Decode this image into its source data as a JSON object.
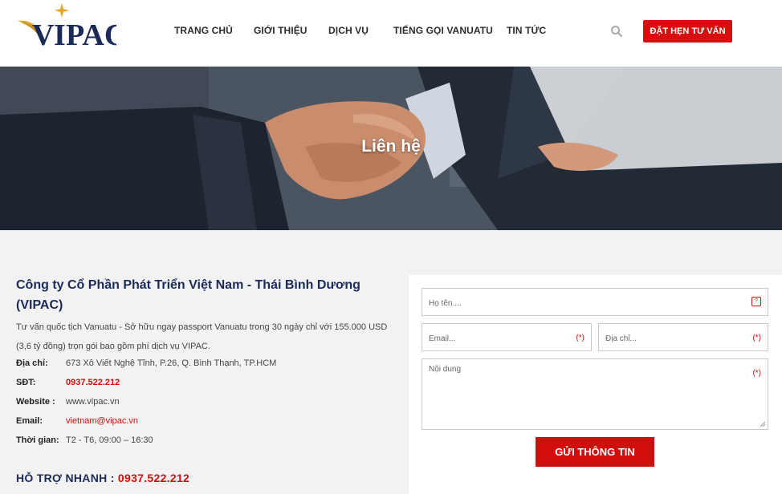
{
  "header": {
    "logo_text": "VIPAC",
    "nav": [
      {
        "label": "TRANG CHỦ"
      },
      {
        "label": "GIỚI THIỆU"
      },
      {
        "label": "DỊCH VỤ"
      },
      {
        "label": "TIẾNG GỌI VANUATU"
      },
      {
        "label": "TIN TỨC"
      }
    ],
    "search_icon": "search-icon",
    "cta_label": "ĐẶT HẸN TƯ VẤN"
  },
  "banner": {
    "title": "Liên hệ"
  },
  "contact": {
    "company_name": "Công ty Cổ Phần Phát Triển Việt Nam - Thái Bình Dương (VIPAC)",
    "description": "Tư vấn quốc tịch Vanuatu - Sở hữu ngay passport Vanuatu trong 30 ngày chỉ với 155.000 USD (3,6 tỷ đồng) trọn gói bao gồm phí dịch vụ VIPAC.",
    "rows": [
      {
        "label": "Địa chỉ:",
        "value": "673 Xô Viết Nghệ Tĩnh, P.26, Q. Bình Thạnh, TP.HCM"
      },
      {
        "label": "SĐT:",
        "value": "0937.522.212"
      },
      {
        "label": "Website",
        "value": "www.vipac.vn"
      },
      {
        "label": "Email:",
        "value": "vietnam@vipac.vn"
      },
      {
        "label": "Thời gian:",
        "value": "T2 - T6, 09:00 – 16:30"
      }
    ],
    "hotline_label": "HỖ TRỢ NHANH :",
    "hotline_number": "0937.522.212"
  },
  "form": {
    "name_placeholder": "Họ tên....",
    "email_placeholder": "Email...",
    "address_placeholder": "Địa chỉ...",
    "content_placeholder": "Nội dung",
    "required_mark": "(*)",
    "submit_label": "GỬI THÔNG TIN"
  },
  "colors": {
    "brand_red": "#d10d0d",
    "brand_navy": "#1c2a57",
    "logo_gold": "#e0a82e"
  }
}
